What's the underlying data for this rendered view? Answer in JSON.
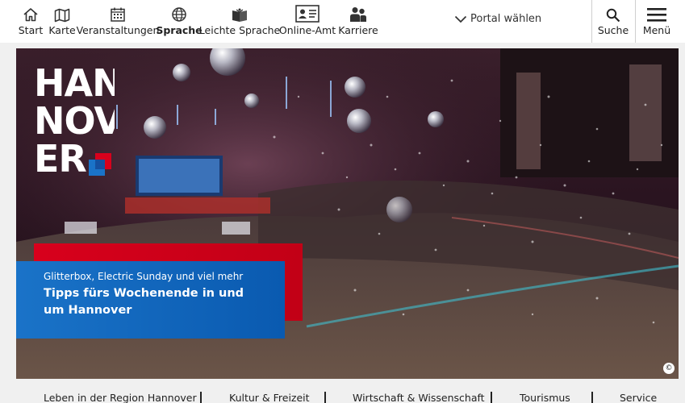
{
  "topnav": {
    "items": [
      {
        "label": "Start",
        "icon": "home-icon"
      },
      {
        "label": "Karte",
        "icon": "map-icon"
      },
      {
        "label": "Veranstaltungen",
        "icon": "calendar-icon"
      },
      {
        "label": "Sprache",
        "icon": "globe-icon"
      },
      {
        "label": "Leichte Sprache",
        "icon": "easy-language-book-icon"
      },
      {
        "label": "Online-Amt",
        "icon": "id-card-icon"
      },
      {
        "label": "Karriere",
        "icon": "people-icon"
      }
    ],
    "portal_label": "Portal wählen",
    "search_label": "Suche",
    "menu_label": "Menü"
  },
  "hero": {
    "logo_lines": [
      "HAN",
      "NOV",
      "ER"
    ],
    "teaser_subtitle": "Glitterbox, Electric Sunday und viel mehr",
    "teaser_title": "Tipps fürs Wochenende in und um Hannover",
    "copyright_symbol": "©"
  },
  "categories": [
    "Leben in der Region Hannover",
    "Kultur & Freizeit",
    "Wirtschaft & Wissenschaft",
    "Tourismus",
    "Service"
  ],
  "colors": {
    "teaser_red": "#d8001c",
    "teaser_blue": "#1a73c8",
    "logo_blue": "#1a73c8",
    "logo_red": "#d8001c"
  }
}
